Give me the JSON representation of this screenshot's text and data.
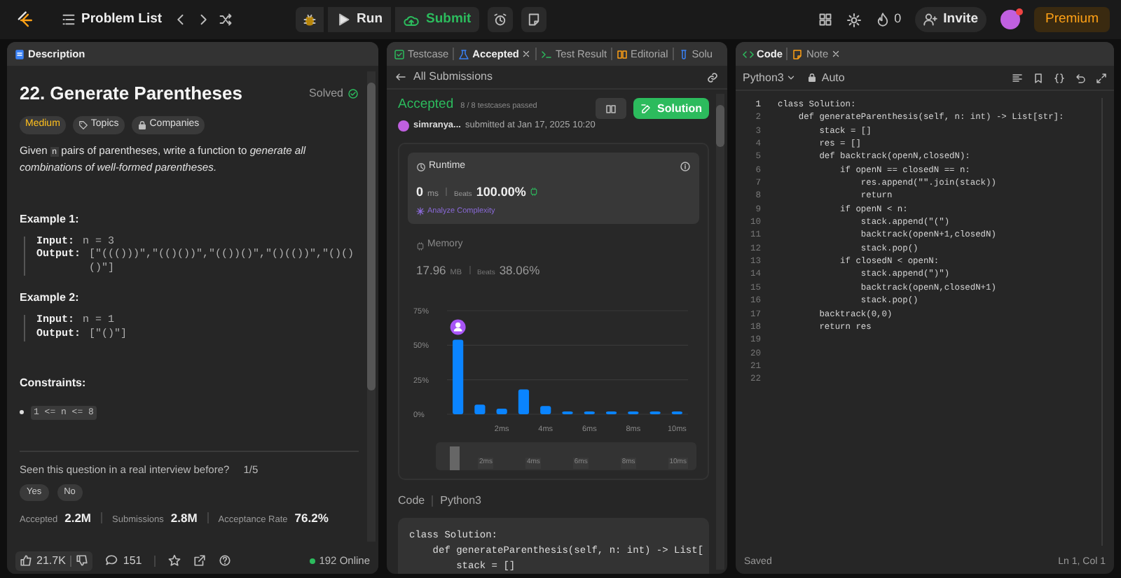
{
  "top_bar": {
    "title": "Problem List",
    "run": "Run",
    "submit": "Submit",
    "streak": "0",
    "invite": "Invite",
    "premium": "Premium"
  },
  "description_panel": {
    "tabs": [
      {
        "label": "Description",
        "selected": true
      }
    ],
    "title": "22. Generate Parentheses",
    "status": "Solved",
    "tags": [
      {
        "kind": "difficulty",
        "label": "Medium"
      },
      {
        "kind": "topics",
        "label": "Topics"
      },
      {
        "kind": "companies",
        "label": "Companies"
      }
    ],
    "intro": {
      "before": "Given",
      "code": "n",
      "after": "pairs of parentheses, write a function to *generate all combinations of well-formed parentheses.*"
    },
    "examples": [
      {
        "heading": "Example 1:",
        "input_label": "Input:",
        "input": "n = 3",
        "output_label": "Output:",
        "output": "[\"((()))\",\"(()())\",\"(())()\",\"()(())\",\"()()()\"]"
      },
      {
        "heading": "Example 2:",
        "input_label": "Input:",
        "input": "n = 1",
        "output_label": "Output:",
        "output": "[\"()\"]"
      }
    ],
    "constraints_heading": "Constraints:",
    "constraints": [
      "1 <= n <= 8"
    ],
    "interview_question": "Seen this question in a real interview before?",
    "interview_count": "1/5",
    "answers": [
      "Yes",
      "No"
    ],
    "stats": [
      {
        "label": "Accepted",
        "value": "2.2M"
      },
      {
        "label": "Submissions",
        "value": "2.8M"
      },
      {
        "label": "Acceptance Rate",
        "value": "76.2%"
      }
    ],
    "footer": {
      "likes": "21.7K",
      "comments": "151",
      "online": "192 Online"
    }
  },
  "submission_panel": {
    "tabs": [
      {
        "label": "Testcase",
        "selected": false
      },
      {
        "label": "Accepted",
        "selected": true,
        "closable": true
      },
      {
        "label": "Test Result",
        "selected": false
      },
      {
        "label": "Editorial",
        "selected": false
      },
      {
        "label": "Solu",
        "selected": false
      }
    ],
    "back_link": "All Submissions",
    "verdict": "Accepted",
    "testcases": "8 / 8 testcases passed",
    "user": "simranya...",
    "submitted": "submitted at Jan 17, 2025 10:20",
    "solution_button": "Solution",
    "runtime": {
      "title": "Runtime",
      "value": "0",
      "unit": "ms",
      "beats_label": "Beats",
      "beats": "100.00%",
      "analyze": "Analyze Complexity"
    },
    "memory": {
      "title": "Memory",
      "value": "17.96",
      "unit": "MB",
      "beats_label": "Beats",
      "beats": "38.06%"
    },
    "chart_data": {
      "type": "bar",
      "x": [
        0,
        1,
        2,
        3,
        4,
        5,
        6,
        7,
        8,
        9,
        10
      ],
      "xlim": [
        -0.5,
        10.5
      ],
      "series": [
        {
          "color": "#0a84ff",
          "values": [
            54,
            7,
            4,
            18,
            6,
            2,
            2,
            2,
            2,
            2,
            2
          ]
        }
      ],
      "ylim": [
        0,
        75
      ],
      "yticks": [
        {
          "value": 0,
          "label": "0%"
        },
        {
          "value": 25,
          "label": "25%"
        },
        {
          "value": 50,
          "label": "50%"
        },
        {
          "value": 75,
          "label": "75%"
        }
      ],
      "xticks": [
        {
          "value": 2,
          "label": "2ms"
        },
        {
          "value": 4,
          "label": "4ms"
        },
        {
          "value": 6,
          "label": "6ms"
        },
        {
          "value": 8,
          "label": "8ms"
        },
        {
          "value": 10,
          "label": "10ms"
        }
      ]
    },
    "overview_labels": [
      "2ms",
      "4ms",
      "6ms",
      "8ms",
      "10ms"
    ],
    "code_label": "Code",
    "language": "Python3",
    "code_lines": [
      "class Solution:",
      "    def generateParenthesis(self, n: int) -> List[",
      "        stack = []"
    ]
  },
  "editor_panel": {
    "tabs": [
      {
        "label": "Code",
        "selected": true
      },
      {
        "label": "Note",
        "selected": false,
        "closable": true
      }
    ],
    "language": "Python3",
    "mode": "Auto",
    "lines": [
      {
        "number": "1",
        "text": "class Solution:"
      },
      {
        "number": "2",
        "text": "    def generateParenthesis(self, n: int) -> List[str]:"
      },
      {
        "number": "3",
        "text": "        stack = []"
      },
      {
        "number": "4",
        "text": "        res = []"
      },
      {
        "number": "5",
        "text": "        def backtrack(openN,closedN):"
      },
      {
        "number": "6",
        "text": "            if openN == closedN == n:"
      },
      {
        "number": "7",
        "text": "                res.append(\"\".join(stack))"
      },
      {
        "number": "8",
        "text": "                return"
      },
      {
        "number": "9",
        "text": "            if openN < n:"
      },
      {
        "number": "10",
        "text": "                stack.append(\"(\")"
      },
      {
        "number": "11",
        "text": "                backtrack(openN+1,closedN)"
      },
      {
        "number": "12",
        "text": "                stack.pop()"
      },
      {
        "number": "13",
        "text": "            if closedN < openN:"
      },
      {
        "number": "14",
        "text": "                stack.append(\")\")"
      },
      {
        "number": "15",
        "text": "                backtrack(openN,closedN+1)"
      },
      {
        "number": "16",
        "text": "                stack.pop()"
      },
      {
        "number": "17",
        "text": "        backtrack(0,0)"
      },
      {
        "number": "18",
        "text": "        return res"
      },
      {
        "number": "19"
      },
      {
        "number": "20"
      },
      {
        "number": "21"
      },
      {
        "number": "22"
      }
    ],
    "status": "Saved",
    "cursor": "Ln 1, Col 1"
  }
}
